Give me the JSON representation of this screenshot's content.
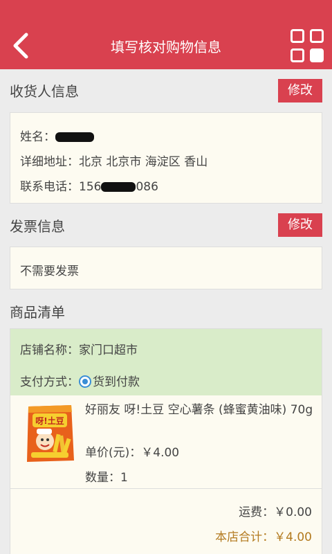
{
  "header": {
    "title": "填写核对购物信息",
    "back_icon": "chevron-left-icon",
    "menu_icon": "grid-icon",
    "color": "#d9414f"
  },
  "consignee": {
    "section_title": "收货人信息",
    "edit_label": "修改",
    "name_label": "姓名：",
    "address_label": "详细地址：",
    "address_value": "北京 北京市 海淀区 香山",
    "phone_label": "联系电话：",
    "phone_prefix": "156",
    "phone_suffix": "086"
  },
  "invoice": {
    "section_title": "发票信息",
    "edit_label": "修改",
    "value": "不需要发票"
  },
  "goods": {
    "section_title": "商品清单",
    "shop_label": "店铺名称：",
    "shop_name": "家门口超市",
    "payment_label": "支付方式：",
    "payment_option": "货到付款",
    "product_name": "好丽友 呀!土豆 空心薯条 (蜂蜜黄油味) 70g",
    "price_text": "单价(元)：￥4.00",
    "quantity_text": "数量：1",
    "package_text": "呀!土豆",
    "shipping_text": "运费：￥0.00",
    "total_text": "本店合计：￥4.00",
    "total_color": "#b37a1f"
  }
}
